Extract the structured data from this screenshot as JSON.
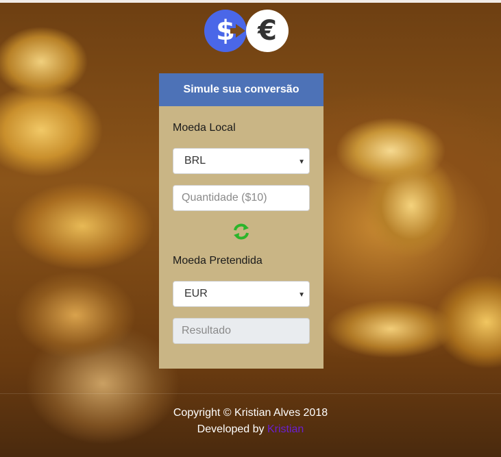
{
  "header": {
    "logo": {
      "left_symbol": "$",
      "right_symbol": "€",
      "left_color": "#4a67e8",
      "arrow_color": "#7a4b1b"
    }
  },
  "card": {
    "title": "Simule sua conversão",
    "header_color": "#4d72b7",
    "body_color": "#c9b585",
    "local_currency_label": "Moeda Local",
    "local_currency_selected": "BRL",
    "amount_placeholder": "Quantidade ($10)",
    "swap_icon": "refresh-icon",
    "target_currency_label": "Moeda Pretendida",
    "target_currency_selected": "EUR",
    "result_placeholder": "Resultado"
  },
  "footer": {
    "copyright": "Copyright © Kristian Alves 2018",
    "developed_prefix": "Developed by",
    "developer_link": "Kristian",
    "link_color": "#6a1fd0"
  }
}
